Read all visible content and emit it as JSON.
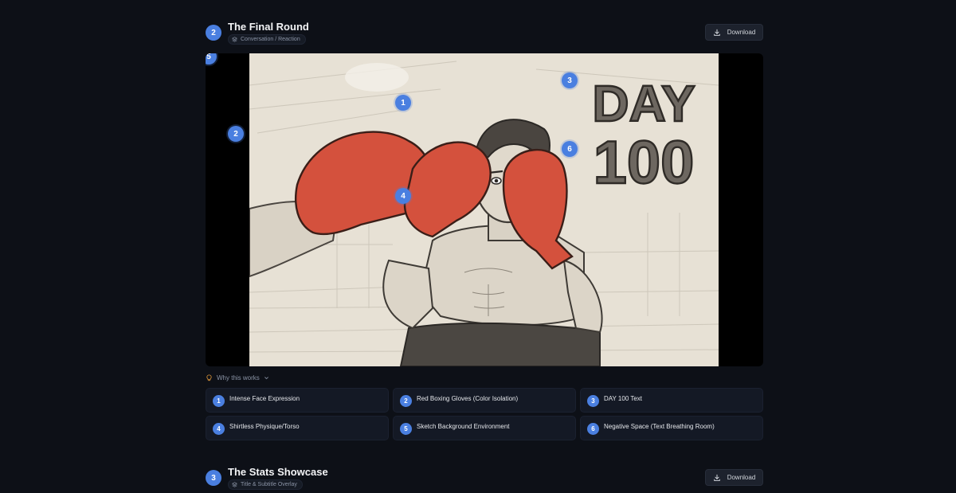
{
  "sections": [
    {
      "number": "2",
      "title": "The Final Round",
      "tag": "Conversation / Reaction",
      "download_label": "Download",
      "image": {
        "subject": "Pencil sketch of shirtless boxer with red gloves and DAY 100 text",
        "overlay_text_line1": "DAY",
        "overlay_text_line2": "100",
        "markers": [
          "1",
          "2",
          "3",
          "4",
          "5",
          "6"
        ]
      },
      "why_label": "Why this works",
      "reasons": [
        {
          "num": "1",
          "label": "Intense Face Expression"
        },
        {
          "num": "2",
          "label": "Red Boxing Gloves (Color Isolation)"
        },
        {
          "num": "3",
          "label": "DAY 100 Text"
        },
        {
          "num": "4",
          "label": "Shirtless Physique/Torso"
        },
        {
          "num": "5",
          "label": "Sketch Background Environment"
        },
        {
          "num": "6",
          "label": "Negative Space (Text Breathing Room)"
        }
      ]
    },
    {
      "number": "3",
      "title": "The Stats Showcase",
      "tag": "Title & Subtitle Overlay",
      "download_label": "Download"
    }
  ],
  "colors": {
    "background": "#0d1017",
    "accent": "#4a7fe0",
    "card": "#141925",
    "glove_red": "#d4513d",
    "why_icon": "#e39a3a"
  }
}
